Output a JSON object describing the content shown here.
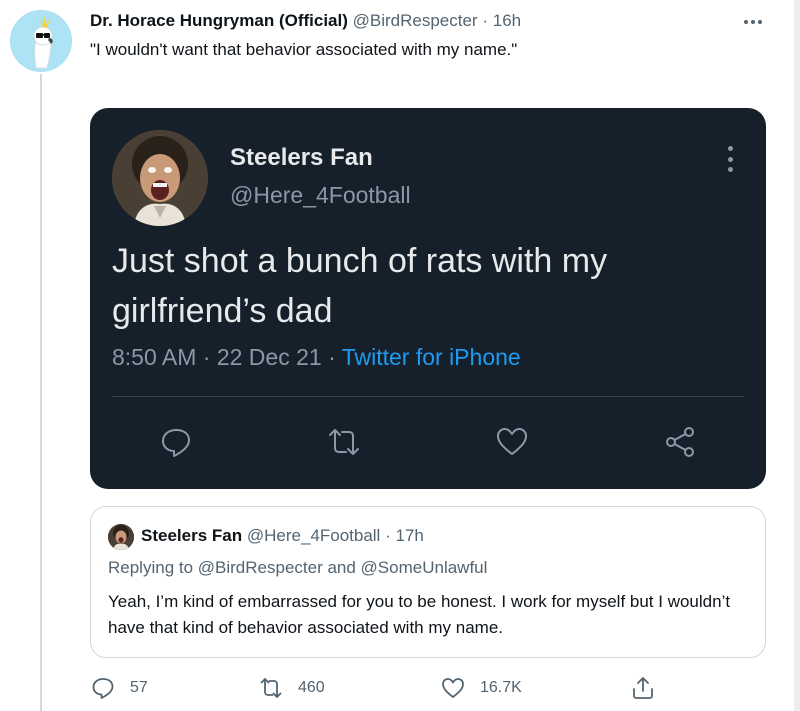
{
  "tweet": {
    "author_name": "Dr. Horace Hungryman (Official)",
    "author_handle": "@BirdRespecter",
    "separator": "·",
    "time": "16h",
    "text": "\"I wouldn't want that behavior associated with my name.\""
  },
  "embedded_screenshot": {
    "author_name": "Steelers Fan",
    "author_handle": "@Here_4Football",
    "text": "Just shot a bunch of rats with my girlfriend’s dad",
    "timestamp": "8:50 AM · 22 Dec 21",
    "separator": " · ",
    "source": "Twitter for iPhone",
    "actions": [
      "reply-icon",
      "retweet-icon",
      "like-icon",
      "share-icon"
    ]
  },
  "quoted_tweet": {
    "author_name": "Steelers Fan",
    "author_handle": "@Here_4Football",
    "separator": "·",
    "time": "17h",
    "replying_to": "Replying to @BirdRespecter and @SomeUnlawful",
    "text": "Yeah, I’m kind of embarrassed for you to be honest. I work for myself but I wouldn’t have that kind of behavior associated with my name."
  },
  "actions": {
    "replies": "57",
    "retweets": "460",
    "likes": "16.7K"
  },
  "colors": {
    "dark_bg": "#15202b",
    "link_blue": "#1d9bf0",
    "secondary_text": "#536471",
    "border": "#cfd9de"
  }
}
